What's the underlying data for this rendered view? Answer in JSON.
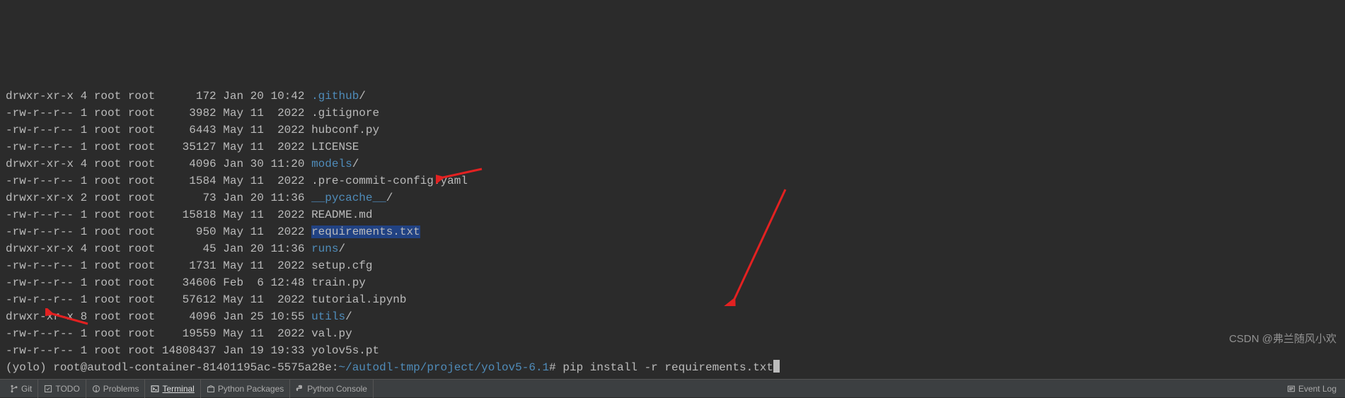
{
  "listing": [
    {
      "perm": "drwxr-xr-x",
      "links": "4",
      "owner": "root",
      "group": "root",
      "size": "172",
      "date": "Jan 20 10:42",
      "name": ".github",
      "is_dir": true,
      "highlight": false
    },
    {
      "perm": "-rw-r--r--",
      "links": "1",
      "owner": "root",
      "group": "root",
      "size": "3982",
      "date": "May 11  2022",
      "name": ".gitignore",
      "is_dir": false,
      "highlight": false
    },
    {
      "perm": "-rw-r--r--",
      "links": "1",
      "owner": "root",
      "group": "root",
      "size": "6443",
      "date": "May 11  2022",
      "name": "hubconf.py",
      "is_dir": false,
      "highlight": false
    },
    {
      "perm": "-rw-r--r--",
      "links": "1",
      "owner": "root",
      "group": "root",
      "size": "35127",
      "date": "May 11  2022",
      "name": "LICENSE",
      "is_dir": false,
      "highlight": false
    },
    {
      "perm": "drwxr-xr-x",
      "links": "4",
      "owner": "root",
      "group": "root",
      "size": "4096",
      "date": "Jan 30 11:20",
      "name": "models",
      "is_dir": true,
      "highlight": false
    },
    {
      "perm": "-rw-r--r--",
      "links": "1",
      "owner": "root",
      "group": "root",
      "size": "1584",
      "date": "May 11  2022",
      "name": ".pre-commit-config.yaml",
      "is_dir": false,
      "highlight": false
    },
    {
      "perm": "drwxr-xr-x",
      "links": "2",
      "owner": "root",
      "group": "root",
      "size": "73",
      "date": "Jan 20 11:36",
      "name": "__pycache__",
      "is_dir": true,
      "highlight": false
    },
    {
      "perm": "-rw-r--r--",
      "links": "1",
      "owner": "root",
      "group": "root",
      "size": "15818",
      "date": "May 11  2022",
      "name": "README.md",
      "is_dir": false,
      "highlight": false
    },
    {
      "perm": "-rw-r--r--",
      "links": "1",
      "owner": "root",
      "group": "root",
      "size": "950",
      "date": "May 11  2022",
      "name": "requirements.txt",
      "is_dir": false,
      "highlight": true
    },
    {
      "perm": "drwxr-xr-x",
      "links": "4",
      "owner": "root",
      "group": "root",
      "size": "45",
      "date": "Jan 20 11:36",
      "name": "runs",
      "is_dir": true,
      "highlight": false
    },
    {
      "perm": "-rw-r--r--",
      "links": "1",
      "owner": "root",
      "group": "root",
      "size": "1731",
      "date": "May 11  2022",
      "name": "setup.cfg",
      "is_dir": false,
      "highlight": false
    },
    {
      "perm": "-rw-r--r--",
      "links": "1",
      "owner": "root",
      "group": "root",
      "size": "34606",
      "date": "Feb  6 12:48",
      "name": "train.py",
      "is_dir": false,
      "highlight": false
    },
    {
      "perm": "-rw-r--r--",
      "links": "1",
      "owner": "root",
      "group": "root",
      "size": "57612",
      "date": "May 11  2022",
      "name": "tutorial.ipynb",
      "is_dir": false,
      "highlight": false
    },
    {
      "perm": "drwxr-xr-x",
      "links": "8",
      "owner": "root",
      "group": "root",
      "size": "4096",
      "date": "Jan 25 10:55",
      "name": "utils",
      "is_dir": true,
      "highlight": false
    },
    {
      "perm": "-rw-r--r--",
      "links": "1",
      "owner": "root",
      "group": "root",
      "size": "19559",
      "date": "May 11  2022",
      "name": "val.py",
      "is_dir": false,
      "highlight": false
    },
    {
      "perm": "-rw-r--r--",
      "links": "1",
      "owner": "root",
      "group": "root",
      "size": "14808437",
      "date": "Jan 19 19:33",
      "name": "yolov5s.pt",
      "is_dir": false,
      "highlight": false
    }
  ],
  "prompt": {
    "env": "(yolo) ",
    "user_host": "root@autodl-container-81401195ac-5575a28e",
    "sep": ":",
    "path": "~/autodl-tmp/project/yolov5-6.1",
    "hash": "# ",
    "command": "pip install -r requirements.txt"
  },
  "statusbar": {
    "git": "Git",
    "todo": "TODO",
    "problems": "Problems",
    "terminal": "Terminal",
    "packages": "Python Packages",
    "console": "Python Console",
    "eventlog": "Event Log"
  },
  "watermark": "CSDN @弗兰随风小欢"
}
